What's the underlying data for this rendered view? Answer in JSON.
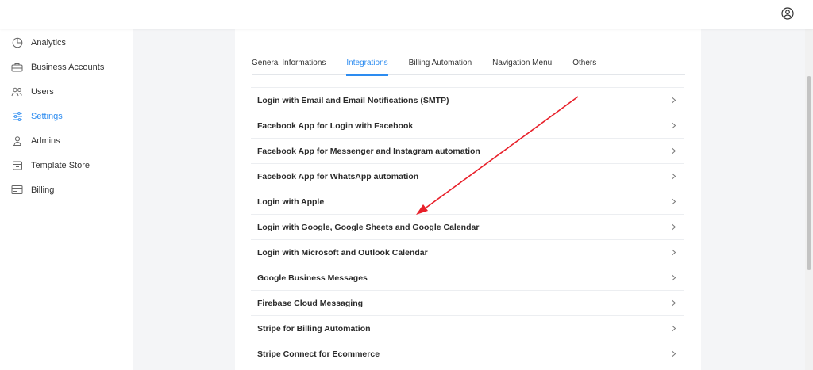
{
  "sidebar": {
    "items": [
      {
        "label": "Analytics",
        "icon": "analytics-icon",
        "active": false
      },
      {
        "label": "Business Accounts",
        "icon": "business-accounts-icon",
        "active": false
      },
      {
        "label": "Users",
        "icon": "users-icon",
        "active": false
      },
      {
        "label": "Settings",
        "icon": "settings-icon",
        "active": true
      },
      {
        "label": "Admins",
        "icon": "admins-icon",
        "active": false
      },
      {
        "label": "Template Store",
        "icon": "store-icon",
        "active": false
      },
      {
        "label": "Billing",
        "icon": "billing-icon",
        "active": false
      }
    ]
  },
  "header": {
    "profile_icon": "user-circle-icon"
  },
  "tabs": [
    {
      "label": "General Informations",
      "active": false
    },
    {
      "label": "Integrations",
      "active": true
    },
    {
      "label": "Billing Automation",
      "active": false
    },
    {
      "label": "Navigation Menu",
      "active": false
    },
    {
      "label": "Others",
      "active": false
    }
  ],
  "integrations": [
    "Login with Email and Email Notifications (SMTP)",
    "Facebook App for Login with Facebook",
    "Facebook App for Messenger and Instagram automation",
    "Facebook App for WhatsApp automation",
    "Login with Apple",
    "Login with Google, Google Sheets and Google Calendar",
    "Login with Microsoft and Outlook Calendar",
    "Google Business Messages",
    "Firebase Cloud Messaging",
    "Stripe for Billing Automation",
    "Stripe Connect for Ecommerce"
  ],
  "colors": {
    "accent": "#2d8cf0",
    "annotation_arrow": "#e8202a"
  }
}
